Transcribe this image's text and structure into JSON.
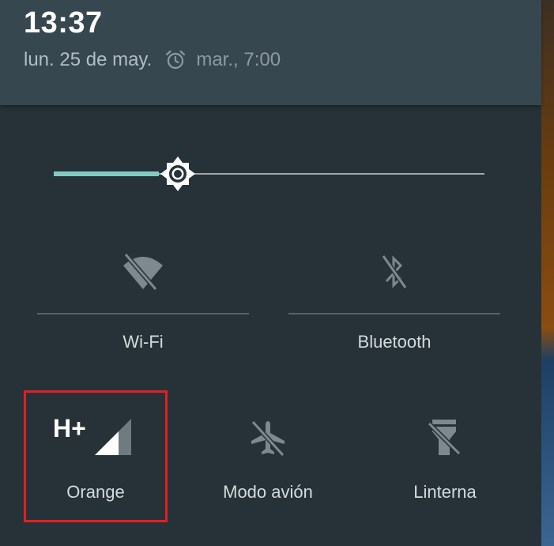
{
  "status": {
    "time": "13:37",
    "date": "lun. 25 de may.",
    "alarm_icon": "alarm-clock-icon",
    "alarm_time": "mar., 7:00"
  },
  "brightness": {
    "level": 0.24,
    "icon": "brightness-sun-icon",
    "track_fill_color": "#80cbc4"
  },
  "tiles": {
    "wifi": {
      "label": "Wi-Fi",
      "icon": "wifi-off-icon",
      "state": "off"
    },
    "bluetooth": {
      "label": "Bluetooth",
      "icon": "bluetooth-off-icon",
      "state": "off"
    },
    "mobile": {
      "label": "Orange",
      "network_type": "H+",
      "icon": "cell-signal-icon",
      "state": "on"
    },
    "airplane": {
      "label": "Modo avión",
      "icon": "airplane-off-icon",
      "state": "off"
    },
    "flashlight": {
      "label": "Linterna",
      "icon": "flashlight-off-icon",
      "state": "off"
    }
  },
  "colors": {
    "header_bg": "#37474f",
    "panel_bg": "#263238",
    "highlight": "#e31e24",
    "inactive_icon": "#7d898f"
  }
}
